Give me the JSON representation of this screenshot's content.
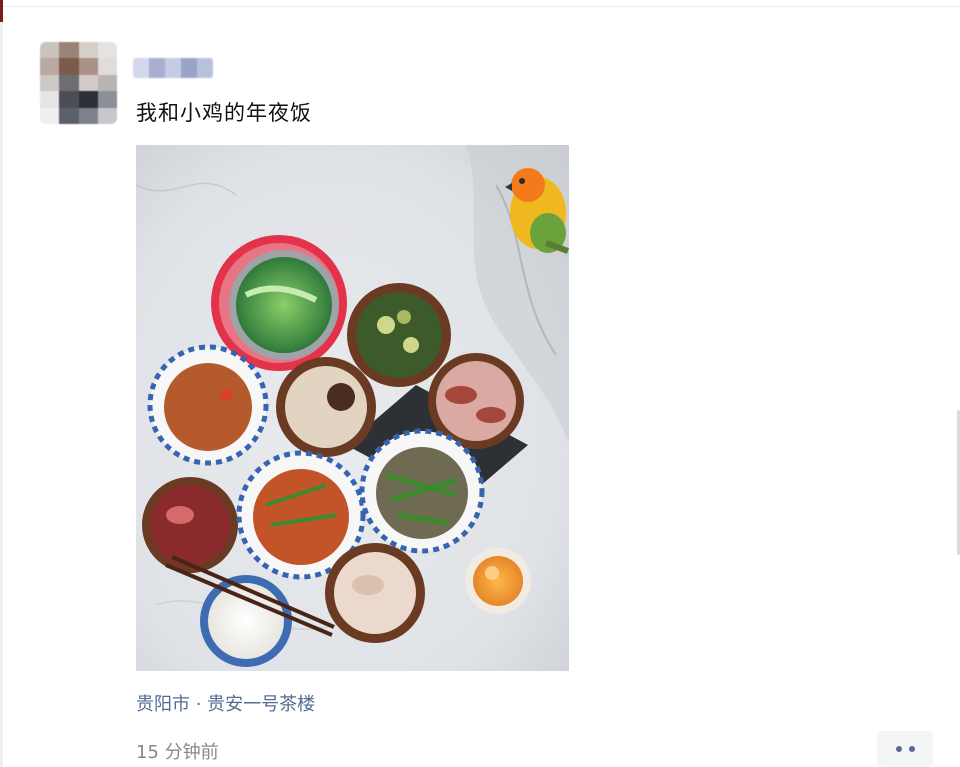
{
  "post": {
    "text": "我和小鸡的年夜饭",
    "location": "贵阳市 · 贵安一号茶楼",
    "time": "15 分钟前"
  },
  "user": {
    "avatar_icon": "avatar-blurred",
    "name_icon": "username-blurred"
  },
  "colors": {
    "link": "#566b94",
    "meta": "#888888",
    "text": "#111111"
  },
  "actions": {
    "more_icon": "more-dots-icon"
  }
}
